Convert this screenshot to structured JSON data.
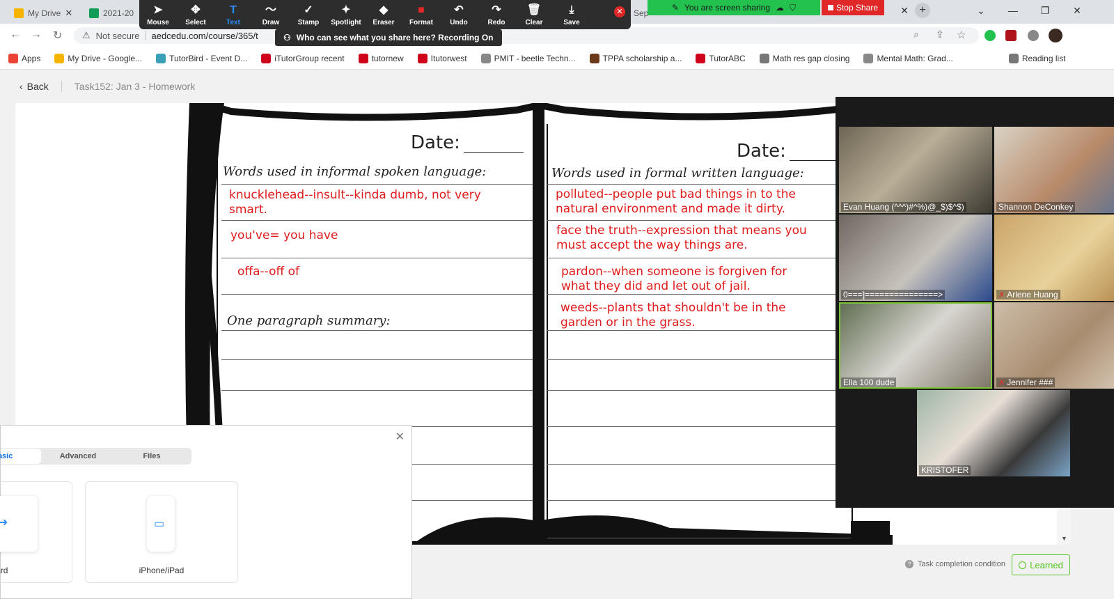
{
  "browser": {
    "tabs": [
      {
        "label": "My Drive",
        "color": "#f4b400"
      },
      {
        "label": "2021-20",
        "color": "#0f9d58"
      },
      {
        "label": "Sep",
        "color": "#4285f4"
      }
    ],
    "not_secure": "Not secure",
    "url": "aedcedu.com/course/365/t",
    "bookmarks": [
      {
        "label": "Apps",
        "color": "#ea4335"
      },
      {
        "label": "My Drive - Google...",
        "color": "#f4b400"
      },
      {
        "label": "TutorBird - Event D...",
        "color": "#3aa0b8"
      },
      {
        "label": "iTutorGroup recent",
        "color": "#d0021b"
      },
      {
        "label": "tutornew",
        "color": "#d0021b"
      },
      {
        "label": "Itutorwest",
        "color": "#d0021b"
      },
      {
        "label": "PMIT - beetle Techn...",
        "color": "#888888"
      },
      {
        "label": "TPPA scholarship a...",
        "color": "#6b3a1b"
      },
      {
        "label": "TutorABC",
        "color": "#d0021b"
      },
      {
        "label": "Math res gap closing",
        "color": "#777777"
      },
      {
        "label": "Mental Math: Grad...",
        "color": "#888888"
      },
      {
        "label": "Reading list",
        "color": "#777777"
      }
    ]
  },
  "zoom_toolbar": {
    "tools": [
      {
        "label": "Mouse",
        "icon": "pointer-icon",
        "glyph": "➤"
      },
      {
        "label": "Select",
        "icon": "move-icon",
        "glyph": "✥"
      },
      {
        "label": "Text",
        "icon": "text-icon",
        "glyph": "T"
      },
      {
        "label": "Draw",
        "icon": "draw-icon",
        "glyph": "〜"
      },
      {
        "label": "Stamp",
        "icon": "stamp-icon",
        "glyph": "✓"
      },
      {
        "label": "Spotlight",
        "icon": "spotlight-icon",
        "glyph": "✦"
      },
      {
        "label": "Eraser",
        "icon": "eraser-icon",
        "glyph": "◆"
      },
      {
        "label": "Format",
        "icon": "format-icon",
        "glyph": "■"
      },
      {
        "label": "Undo",
        "icon": "undo-icon",
        "glyph": "↶"
      },
      {
        "label": "Redo",
        "icon": "redo-icon",
        "glyph": "↷"
      },
      {
        "label": "Clear",
        "icon": "trash-icon",
        "glyph": "🗑"
      },
      {
        "label": "Save",
        "icon": "save-icon",
        "glyph": "⤓"
      }
    ],
    "active_tool": "Text",
    "sharing_text": "You are screen sharing",
    "stop_share": "Stop Share",
    "recording_text": "Who can see what you share here? Recording On"
  },
  "page": {
    "back": "Back",
    "breadcrumb": "Task152:  Jan 3 - Homework",
    "task_condition": "Task completion condition",
    "learned": "Learned"
  },
  "worksheet": {
    "date_label": "Date:",
    "left_heading": "Words used in informal spoken language:",
    "right_heading": "Words used in formal written language:",
    "summary_heading": "One paragraph summary:",
    "left_entries": [
      "knucklehead--insult--kinda dumb, not very smart.",
      "you've= you have",
      "offa--off of"
    ],
    "right_entries": [
      "polluted--people put bad things in to the natural environment and made it dirty.",
      "face the truth--expression that means you must accept the way things are.",
      "pardon--when someone is forgiven for what they did and let out of jail.",
      "weeds--plants that shouldn't be in the garden or in the grass."
    ]
  },
  "participants": [
    {
      "name": "Evan Huang (^^^)#^%)@_$)$^$)",
      "muted": false
    },
    {
      "name": "Shannon DeConkey",
      "muted": false
    },
    {
      "name": "0===]===============>",
      "muted": false
    },
    {
      "name": "Arlene Huang",
      "muted": true
    },
    {
      "name": "Ella 100 dude",
      "muted": false,
      "active_speaker": true
    },
    {
      "name": "Jennifer ###",
      "muted": true
    },
    {
      "name": "KRISTOFER",
      "muted": false
    }
  ],
  "share_dialog": {
    "tabs": [
      "Basic",
      "Advanced",
      "Files"
    ],
    "selected_tab": "Basic",
    "options": [
      "Whiteboard",
      "iPhone/iPad"
    ]
  }
}
